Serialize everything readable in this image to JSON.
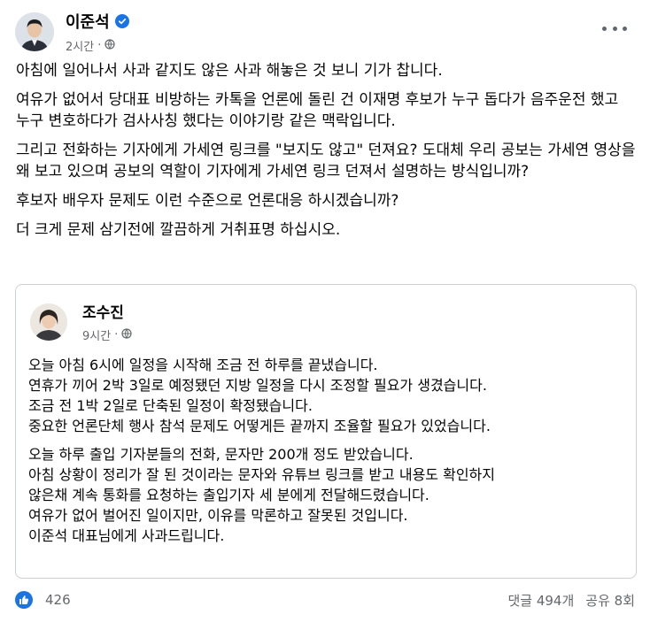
{
  "post": {
    "author": "이준석",
    "verified": true,
    "time": "2시간",
    "privacy_icon": "globe-icon",
    "paragraphs": [
      "아침에 일어나서 사과 같지도 않은 사과 해놓은 것 보니 기가 찹니다.",
      "여유가 없어서 당대표 비방하는 카톡을 언론에 돌린 건 이재명 후보가 누구 돕다가 음주운전 했고 누구 변호하다가 검사사칭 했다는 이야기랑 같은 맥락입니다.",
      "그리고 전화하는 기자에게 가세연 링크를 \"보지도 않고\" 던져요? 도대체 우리 공보는 가세연 영상을 왜 보고 있으며 공보의 역할이 기자에게 가세연 링크 던져서 설명하는 방식입니까?",
      "후보자 배우자 문제도 이런 수준으로 언론대응 하시겠습니까?",
      "더 크게 문제 삼기전에 깔끔하게 거취표명 하십시오."
    ]
  },
  "shared": {
    "author": "조수진",
    "time": "9시간",
    "privacy_icon": "globe-icon",
    "para1": [
      "오늘 아침 6시에 일정을 시작해 조금 전 하루를 끝냈습니다.",
      "연휴가 끼어 2박 3일로 예정됐던 지방 일정을 다시 조정할 필요가 생겼습니다.",
      "조금 전 1박 2일로 단축된 일정이 확정됐습니다.",
      "중요한 언론단체 행사 참석 문제도 어떻게든 끝까지 조율할 필요가 있었습니다."
    ],
    "para2": [
      "오늘 하루 출입 기자분들의 전화, 문자만 200개 정도 받았습니다.",
      "아침 상황이 정리가 잘 된 것이라는 문자와 유튜브 링크를 받고 내용도 확인하지",
      "않은채 계속 통화를 요청하는 출입기자 세 분에게 전달해드렸습니다.",
      "여유가 없어 벌어진 일이지만, 이유를 막론하고 잘못된 것입니다.",
      "이준석 대표님에게 사과드립니다."
    ]
  },
  "footer": {
    "like_count": "426",
    "comments": "댓글 494개",
    "shares": "공유 8회"
  },
  "colors": {
    "brand_blue": "#1b74e4",
    "secondary_text": "#65676b",
    "border": "#ced0d4"
  }
}
